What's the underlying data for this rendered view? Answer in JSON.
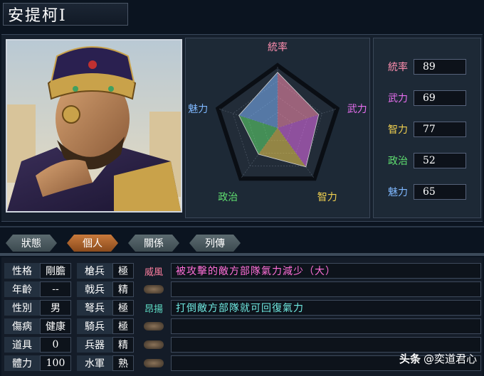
{
  "header": {
    "name": "安提柯Ⅰ"
  },
  "radar": {
    "labels": [
      "統率",
      "武力",
      "智力",
      "政治",
      "魅力"
    ],
    "values": [
      89,
      69,
      77,
      52,
      65
    ],
    "max": 100
  },
  "stats": [
    {
      "label": "統率",
      "value": "89",
      "color": "#ff8fb0"
    },
    {
      "label": "武力",
      "value": "69",
      "color": "#e86ff0"
    },
    {
      "label": "智力",
      "value": "77",
      "color": "#f0d050"
    },
    {
      "label": "政治",
      "value": "52",
      "color": "#60e070"
    },
    {
      "label": "魅力",
      "value": "65",
      "color": "#7fb8ff"
    }
  ],
  "tabs": [
    {
      "label": "狀態",
      "active": false
    },
    {
      "label": "個人",
      "active": true
    },
    {
      "label": "關係",
      "active": false
    },
    {
      "label": "列傳",
      "active": false
    }
  ],
  "personal": {
    "left": [
      {
        "label": "性格",
        "value": "剛膽"
      },
      {
        "label": "年齡",
        "value": "--"
      },
      {
        "label": "性別",
        "value": "男"
      },
      {
        "label": "傷病",
        "value": "健康"
      },
      {
        "label": "道具",
        "value": "0"
      },
      {
        "label": "體力",
        "value": "100"
      }
    ],
    "aptitude": [
      {
        "label": "槍兵",
        "value": "極"
      },
      {
        "label": "戟兵",
        "value": "精"
      },
      {
        "label": "弩兵",
        "value": "極"
      },
      {
        "label": "騎兵",
        "value": "極"
      },
      {
        "label": "兵器",
        "value": "精"
      },
      {
        "label": "水軍",
        "value": "熟"
      }
    ]
  },
  "skills": [
    {
      "name": "威風",
      "desc": "被攻擊的敵方部隊氣力減少（大）",
      "name_color": "#ff7fa0",
      "desc_color": "#ff6fd8"
    },
    {
      "name": "",
      "desc": "",
      "name_color": "",
      "desc_color": ""
    },
    {
      "name": "昂揚",
      "desc": "打倒敵方部隊就可回復氣力",
      "name_color": "#60e0c8",
      "desc_color": "#6fe8e0"
    },
    {
      "name": "",
      "desc": "",
      "name_color": "",
      "desc_color": ""
    },
    {
      "name": "",
      "desc": "",
      "name_color": "",
      "desc_color": ""
    },
    {
      "name": "",
      "desc": "",
      "name_color": "",
      "desc_color": ""
    }
  ],
  "watermark": {
    "brand": "头条",
    "account": "@奕道君心"
  }
}
